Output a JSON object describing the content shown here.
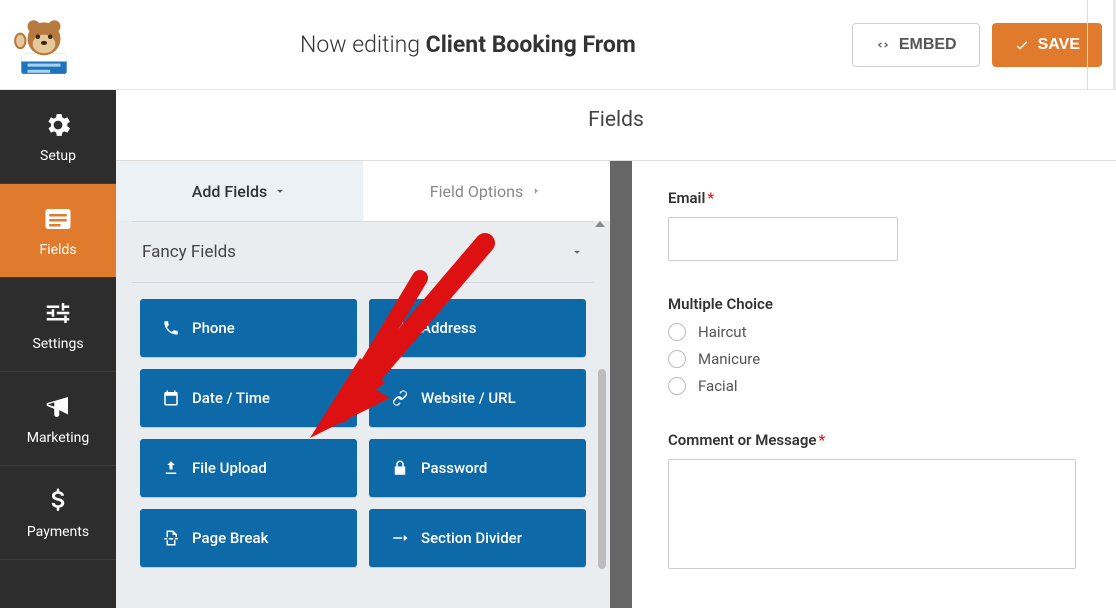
{
  "header": {
    "editing_prefix": "Now editing ",
    "form_name": "Client Booking From",
    "embed_label": "EMBED",
    "save_label": "SAVE"
  },
  "sidebar": {
    "items": [
      {
        "label": "Setup",
        "icon": "gear-icon"
      },
      {
        "label": "Fields",
        "icon": "list-icon"
      },
      {
        "label": "Settings",
        "icon": "sliders-icon"
      },
      {
        "label": "Marketing",
        "icon": "bullhorn-icon"
      },
      {
        "label": "Payments",
        "icon": "dollar-icon"
      }
    ],
    "active_index": 1
  },
  "panel": {
    "section_title": "Fields",
    "tabs": {
      "add_label": "Add Fields",
      "options_label": "Field Options"
    },
    "group_title": "Fancy Fields",
    "fields": [
      {
        "label": "Phone",
        "icon": "phone-icon"
      },
      {
        "label": "Address",
        "icon": "building-icon"
      },
      {
        "label": "Date / Time",
        "icon": "calendar-icon"
      },
      {
        "label": "Website / URL",
        "icon": "link-icon"
      },
      {
        "label": "File Upload",
        "icon": "upload-icon"
      },
      {
        "label": "Password",
        "icon": "lock-icon"
      },
      {
        "label": "Page Break",
        "icon": "pagebreak-icon"
      },
      {
        "label": "Section Divider",
        "icon": "divider-icon"
      }
    ]
  },
  "preview": {
    "email_label": "Email",
    "choice_label": "Multiple Choice",
    "choices": [
      "Haircut",
      "Manicure",
      "Facial"
    ],
    "comment_label": "Comment or Message"
  }
}
